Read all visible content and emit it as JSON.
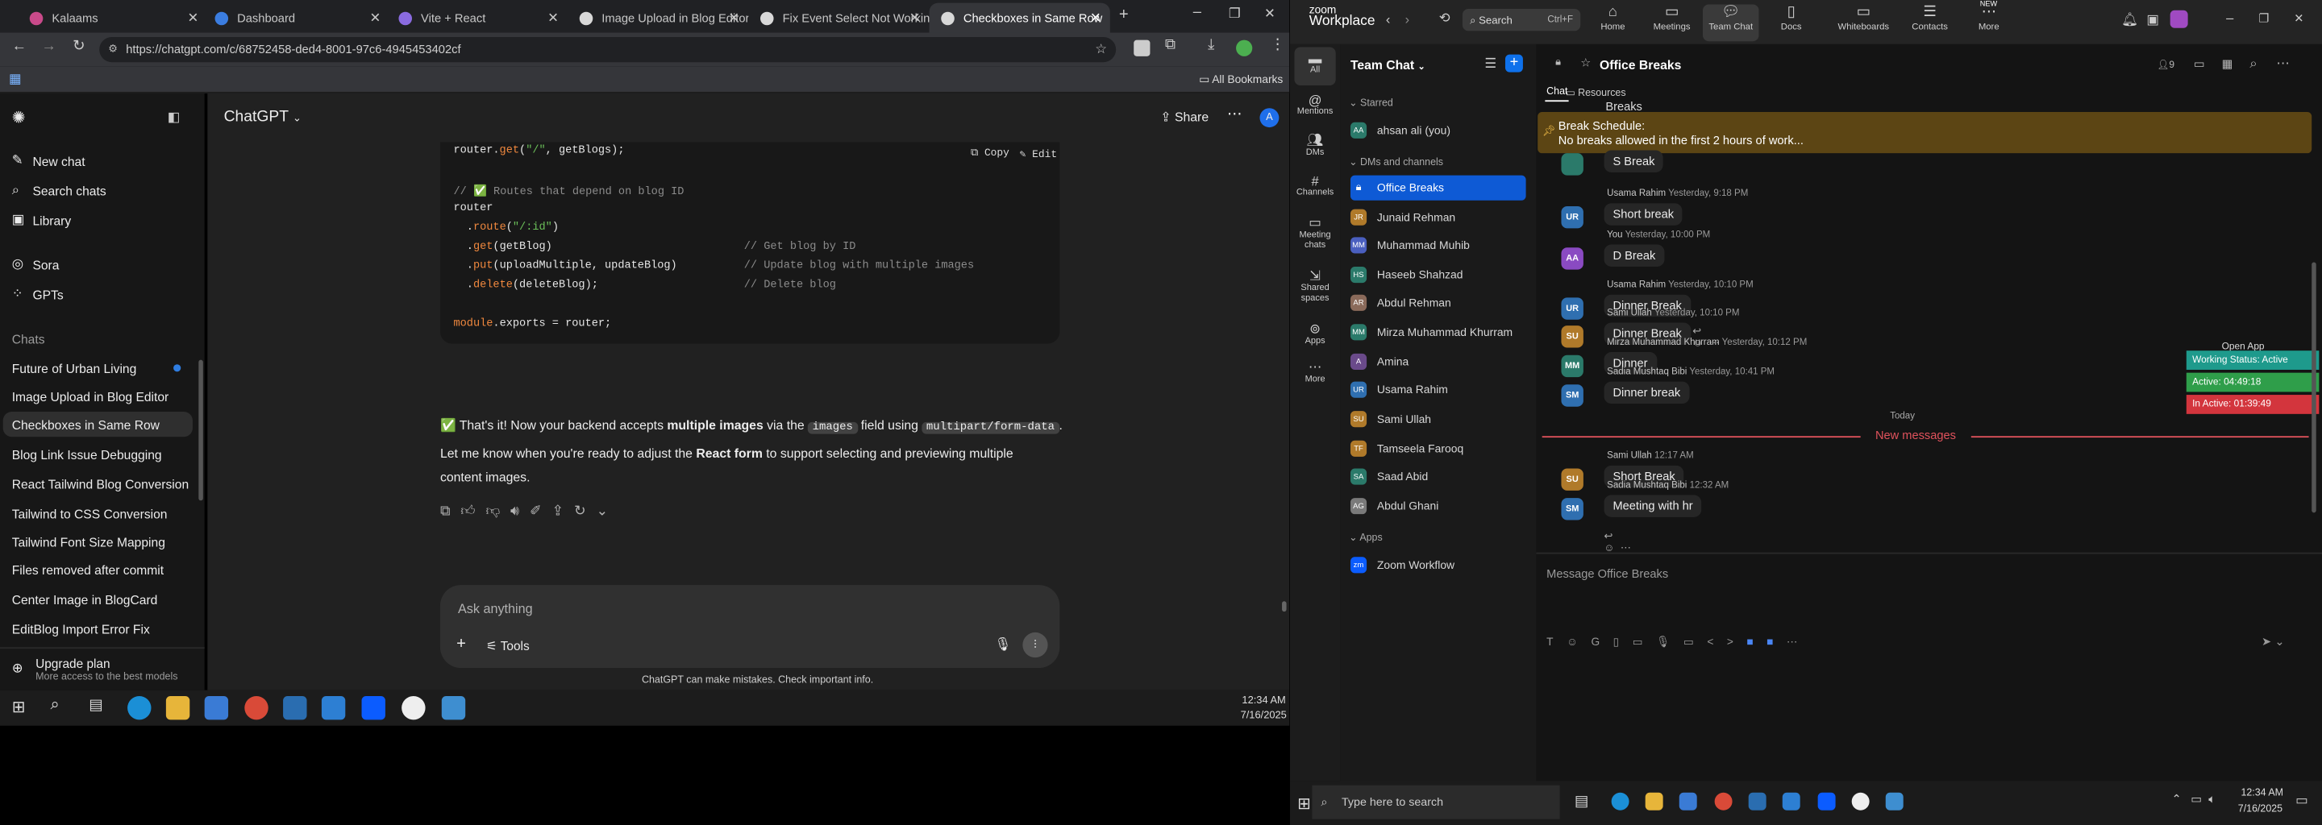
{
  "browser": {
    "tabs": [
      {
        "label": "Kalaams",
        "color": "#c94a8a"
      },
      {
        "label": "Dashboard",
        "color": "#3b7de0"
      },
      {
        "label": "Vite + React",
        "color": "#8a6be0"
      },
      {
        "label": "Image Upload in Blog Editor",
        "color": "#d8d8d8"
      },
      {
        "label": "Fix Event Select Not Working",
        "color": "#d8d8d8"
      },
      {
        "label": "Checkboxes in Same Row",
        "color": "#d8d8d8"
      }
    ],
    "url": "https://chatgpt.com/c/68752458-ded4-8001-97c6-4945453402cf",
    "bookmarks_label": "All Bookmarks"
  },
  "chatgpt": {
    "sidebar": {
      "new_chat": "New chat",
      "search": "Search chats",
      "library": "Library",
      "sora": "Sora",
      "gpts": "GPTs",
      "chats_header": "Chats",
      "chats": [
        "Future of Urban Living",
        "Image Upload in Blog Editor",
        "Checkboxes in Same Row",
        "Blog Link Issue Debugging",
        "React Tailwind Blog Conversion",
        "Tailwind to CSS Conversion",
        "Tailwind Font Size Mapping",
        "Files removed after commit",
        "Center Image in BlogCard",
        "EditBlog Import Error Fix"
      ],
      "upgrade_title": "Upgrade plan",
      "upgrade_sub": "More access to the best models"
    },
    "header": {
      "model": "ChatGPT",
      "share": "Share",
      "avatar": "A"
    },
    "code": {
      "copy": "Copy",
      "edit": "Edit",
      "l1a": "router.",
      "l1b": "get",
      "l1c": "(",
      "l1d": "\"/\"",
      "l1e": ", getBlogs);",
      "l2": "// ✅ Routes that depend on blog ID",
      "l3": "router",
      "l4a": "  .",
      "l4b": "route",
      "l4c": "(",
      "l4d": "\"/:id\"",
      "l4e": ")",
      "l5a": "  .",
      "l5b": "get",
      "l5c": "(getBlog)",
      "l5d": "// Get blog by ID",
      "l6a": "  .",
      "l6b": "put",
      "l6c": "(uploadMultiple, updateBlog)",
      "l6d": "// Update blog with multiple images",
      "l7a": "  .",
      "l7b": "delete",
      "l7c": "(deleteBlog);",
      "l7d": "// Delete blog",
      "l8a": "module",
      "l8b": ".exports = router;"
    },
    "answer": {
      "p1a": "✅ That's it! Now your backend accepts ",
      "p1b": "multiple images",
      "p1c": " via the ",
      "p1d": "images",
      "p1e": " field using ",
      "p1f": "multipart/form-data",
      "p1g": ".",
      "p2a": "Let me know when you're ready to adjust the ",
      "p2b": "React form",
      "p2c": " to support selecting and previewing multiple",
      "p3": "content images."
    },
    "composer": {
      "placeholder": "Ask anything",
      "tools": "Tools"
    },
    "disclaimer": "ChatGPT can make mistakes. Check important info."
  },
  "left_taskbar": {
    "time": "12:34 AM",
    "date": "7/16/2025"
  },
  "zoom": {
    "brand_top": "zoom",
    "brand_bottom": "Workplace",
    "search": "Search",
    "shortcut": "Ctrl+F",
    "nav": [
      "Home",
      "Meetings",
      "Team Chat",
      "Docs",
      "Whiteboards",
      "Contacts",
      "More"
    ],
    "new_badge": "NEW",
    "rail": [
      "All",
      "Mentions",
      "DMs",
      "Channels",
      "Meeting chats",
      "Shared spaces",
      "Apps",
      "More"
    ],
    "list_title": "Team Chat",
    "starred": "Starred",
    "starred_items": [
      "ahsan ali (you)"
    ],
    "dms_header": "DMs and channels",
    "items": [
      "Office Breaks",
      "Junaid Rehman",
      "Muhammad Muhib",
      "Haseeb Shahzad",
      "Abdul Rehman",
      "Mirza Muhammad Khurram",
      "Amina",
      "Usama Rahim",
      "Sami Ullah",
      "Tamseela Farooq",
      "Saad Abid",
      "Abdul Ghani"
    ],
    "apps_header": "Apps",
    "apps": [
      "Zoom Workflow"
    ],
    "channel": "Office Breaks",
    "tab_chat": "Chat",
    "tab_resources": "Resources",
    "members": "9",
    "banner_title": "Break Schedule:",
    "banner_text": "No breaks allowed in the first 2 hours of work...",
    "top_clip": "Breaks",
    "messages": [
      {
        "av": "",
        "name": "",
        "time": "",
        "text": "S Break"
      },
      {
        "av": "UR",
        "name": "Usama Rahim",
        "time": "Yesterday, 9:18 PM",
        "text": "Short break"
      },
      {
        "av": "AA",
        "name": "You",
        "time": "Yesterday, 10:00 PM",
        "text": "D Break"
      },
      {
        "av": "UR",
        "name": "Usama Rahim",
        "time": "Yesterday, 10:10 PM",
        "text": "Dinner Break"
      },
      {
        "av": "SU",
        "name": "Sami Ullah",
        "time": "Yesterday, 10:10 PM",
        "text": "Dinner Break"
      },
      {
        "av": "MM",
        "name": "Mirza Muhammad Khurram",
        "time": "Yesterday, 10:12 PM",
        "text": "Dinner"
      },
      {
        "av": "SM",
        "name": "Sadia Mushtaq Bibi",
        "time": "Yesterday, 10:41 PM",
        "text": "Dinner break"
      },
      {
        "av": "SU",
        "name": "Sami Ullah",
        "time": "12:17 AM",
        "text": "Short Break"
      },
      {
        "av": "SM",
        "name": "Sadia Mushtaq Bibi",
        "time": "12:32 AM",
        "text": "Meeting with hr"
      }
    ],
    "today": "Today",
    "new_messages": "New messages",
    "composer_placeholder": "Message Office Breaks",
    "open_app": "Open App",
    "status": {
      "working": "Working Status: Active",
      "active": "Active: 04:49:18",
      "inactive": "In Active: 01:39:49"
    }
  },
  "right_taskbar": {
    "search": "Type here to search",
    "time": "12:34 AM",
    "date": "7/16/2025"
  },
  "colors": {
    "accent": "#0e71eb",
    "selected": "#0e5ad5",
    "new_messages": "#e0525c",
    "status_green": "#2f9e4a",
    "status_red": "#d3353d",
    "status_teal": "#1e9a8c"
  }
}
